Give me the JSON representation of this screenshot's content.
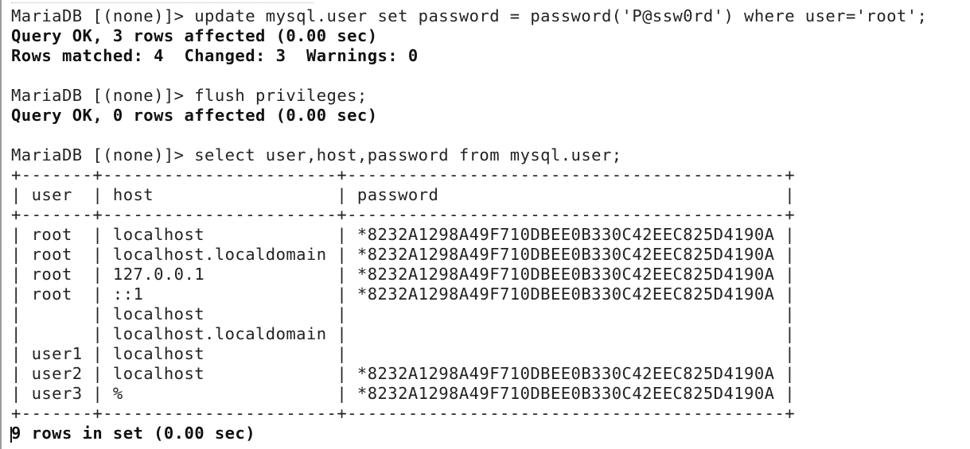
{
  "terminal": {
    "lines": [
      {
        "text": "MariaDB [(none)]> update mysql.user set password = password('P@ssw0rd') where user='root';",
        "style": "normal"
      },
      {
        "text": "Query OK, 3 rows affected (0.00 sec)",
        "style": "bold"
      },
      {
        "text": "Rows matched: 4  Changed: 3  Warnings: 0",
        "style": "bold"
      },
      {
        "text": "",
        "style": "normal"
      },
      {
        "text": "MariaDB [(none)]> flush privileges;",
        "style": "normal"
      },
      {
        "text": "Query OK, 0 rows affected (0.00 sec)",
        "style": "bold"
      },
      {
        "text": "",
        "style": "normal"
      },
      {
        "text": "MariaDB [(none)]> select user,host,password from mysql.user;",
        "style": "normal"
      },
      {
        "text": "+-------+-----------------------+-------------------------------------------+",
        "style": "normal"
      },
      {
        "text": "| user  | host                  | password                                  |",
        "style": "normal"
      },
      {
        "text": "+-------+-----------------------+-------------------------------------------+",
        "style": "normal"
      },
      {
        "text": "| root  | localhost             | *8232A1298A49F710DBEE0B330C42EEC825D4190A |",
        "style": "normal"
      },
      {
        "text": "| root  | localhost.localdomain | *8232A1298A49F710DBEE0B330C42EEC825D4190A |",
        "style": "normal"
      },
      {
        "text": "| root  | 127.0.0.1             | *8232A1298A49F710DBEE0B330C42EEC825D4190A |",
        "style": "normal"
      },
      {
        "text": "| root  | ::1                   | *8232A1298A49F710DBEE0B330C42EEC825D4190A |",
        "style": "normal"
      },
      {
        "text": "|       | localhost             |                                           |",
        "style": "normal"
      },
      {
        "text": "|       | localhost.localdomain |                                           |",
        "style": "normal"
      },
      {
        "text": "| user1 | localhost             |                                           |",
        "style": "normal"
      },
      {
        "text": "| user2 | localhost             | *8232A1298A49F710DBEE0B330C42EEC825D4190A |",
        "style": "normal"
      },
      {
        "text": "| user3 | %                     | *8232A1298A49F710DBEE0B330C42EEC825D4190A |",
        "style": "normal"
      },
      {
        "text": "+-------+-----------------------+-------------------------------------------+",
        "style": "normal"
      },
      {
        "text": "9 rows in set (0.00 sec)",
        "style": "bold"
      }
    ]
  }
}
